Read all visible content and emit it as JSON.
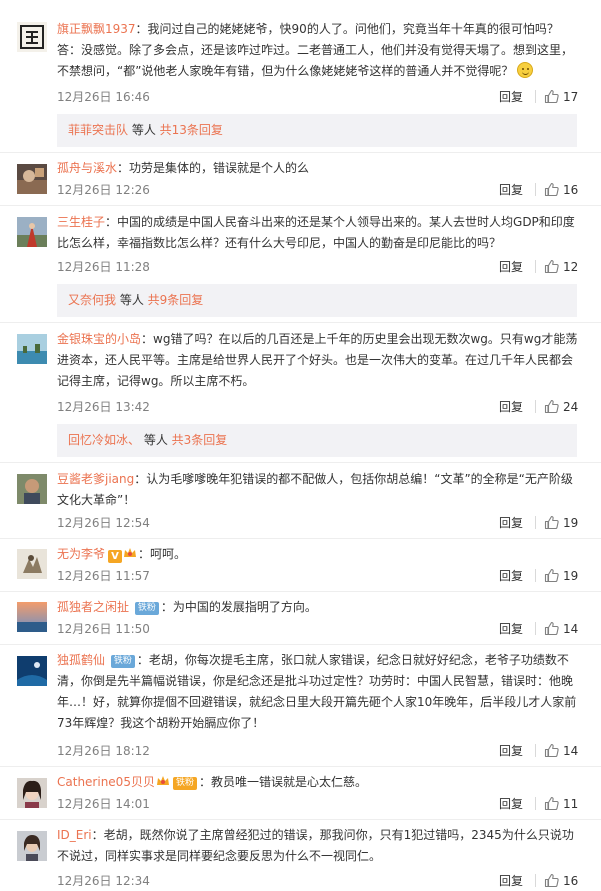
{
  "reply_label": "回复",
  "comments": [
    {
      "user": "旗正飘飘1937",
      "text": "：我问过自己的姥姥姥爷，快90的人了。问他们，究竟当年十年真的很可怕吗？答：没感觉。除了多会点，还是该咋过咋过。二老普通工人，他们并没有觉得天塌了。想到这里，不禁想问，“都”说他老人家晚年有错，但为什么像姥姥姥爷这样的普通人并不觉得呢？",
      "time": "12月26日 16:46",
      "likes": "17",
      "more": {
        "user": "菲菲突击队",
        "mid": " 等人 ",
        "count": "共13条回复"
      }
    },
    {
      "user": "孤舟与溪水",
      "text": "：功劳是集体的，错误就是个人的么",
      "time": "12月26日 12:26",
      "likes": "16"
    },
    {
      "user": "三生桂子",
      "text": "：中国的成绩是中国人民奋斗出来的还是某个人领导出来的。某人去世时人均GDP和印度比怎么样，幸福指数比怎么样？还有什么大号印尼，中国人的勤奋是印尼能比的吗？",
      "time": "12月26日 11:28",
      "likes": "12",
      "more": {
        "user": "又奈何我",
        "mid": " 等人 ",
        "count": "共9条回复"
      }
    },
    {
      "user": "金银珠宝的小岛",
      "text": "：wg错了吗？在以后的几百还是上千年的历史里会出现无数次wg。只有wg才能荡进资本，还人民平等。主席是给世界人民开了个好头。也是一次伟大的变革。在过几千年人民都会记得主席，记得wg。所以主席不朽。",
      "time": "12月26日 13:42",
      "likes": "24",
      "more": {
        "user": "回忆冷如冰、",
        "mid": " 等人 ",
        "count": "共3条回复"
      }
    },
    {
      "user": "豆酱老爹jiang",
      "text": "：认为毛嗲嗲晚年犯错误的都不配做人，包括你胡总编！“文革”的全称是“无产阶级文化大革命”！",
      "time": "12月26日 12:54",
      "likes": "19"
    },
    {
      "user": "无为李爷",
      "text": "：呵呵。",
      "time": "12月26日 11:57",
      "likes": "19"
    },
    {
      "user": "孤独者之闲扯",
      "badge": "铁粉",
      "text": "：为中国的发展指明了方向。",
      "time": "12月26日 11:50",
      "likes": "14"
    },
    {
      "user": "独孤鹤仙",
      "badge": "铁粉",
      "text": "：老胡，你每次提毛主席，张口就人家错误，纪念日就好好纪念，老爷子功绩数不清，你倒是先半篇幅说错误，你是纪念还是批斗功过定性？功劳时：中国人民智慧，错误时：他晚年…！好，就算你提個不回避错误，就纪念日里大段开篇先砸个人家10年晚年，后半段儿才人家前73年辉煌？我这个胡粉开始膈应你了！",
      "time": "12月26日 18:12",
      "likes": "14"
    },
    {
      "user": "Catherine05贝贝",
      "badge": "铁粉",
      "text": "：教员唯一错误就是心太仁慈。",
      "time": "12月26日 14:01",
      "likes": "11"
    },
    {
      "user": "ID_Eri",
      "text": "：老胡，既然你说了主席曾经犯过的错误，那我问你，只有1犯过错吗，2345为什么只说功不说过，同样实事求是同样要纪念要反思为什么不一视同仁。",
      "time": "12月26日 12:34",
      "likes": "16"
    }
  ]
}
